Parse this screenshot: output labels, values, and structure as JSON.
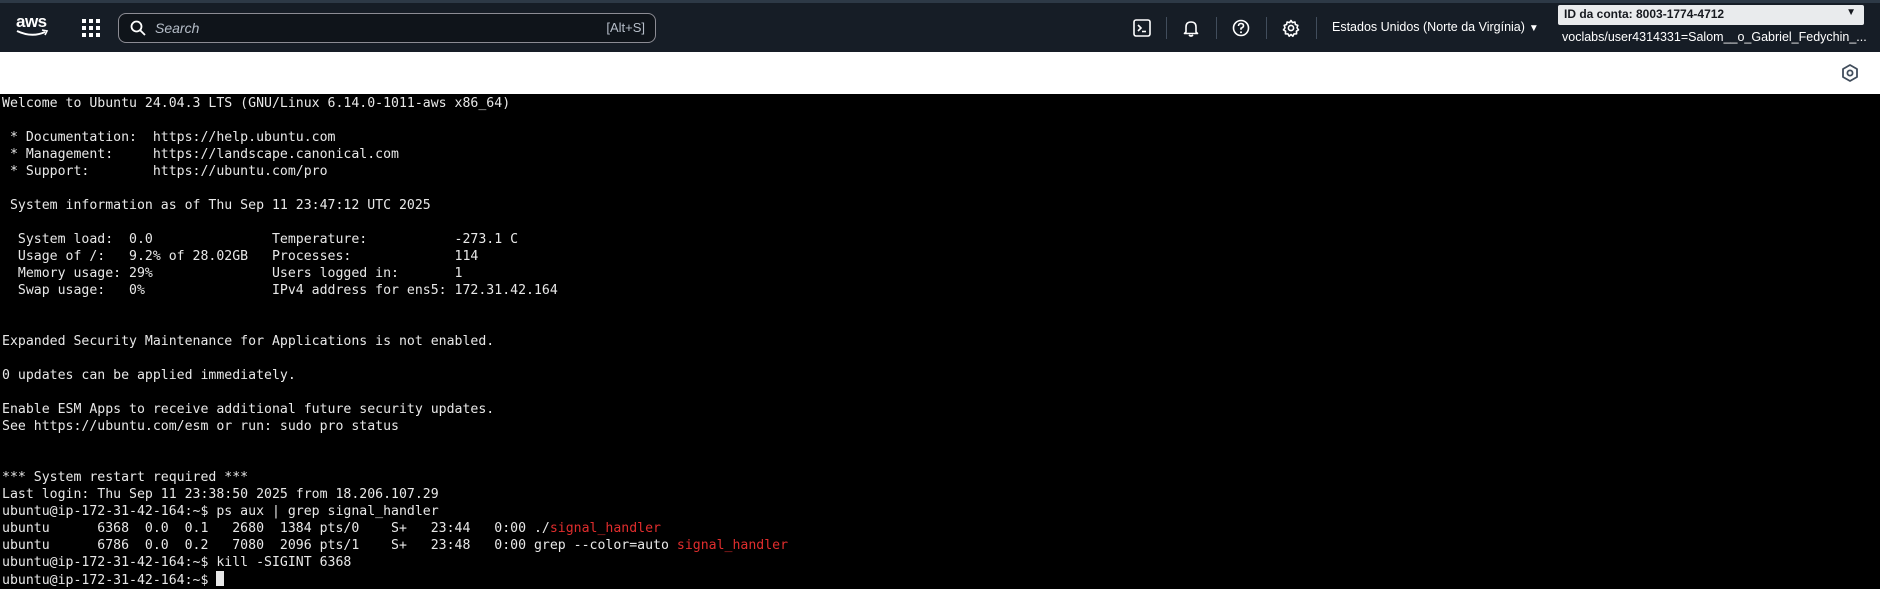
{
  "topbar": {
    "logo_text": "aws",
    "search": {
      "placeholder": "Search",
      "shortcut": "[Alt+S]"
    },
    "icons": [
      "cloudshell-icon",
      "bell-icon",
      "help-icon",
      "gear-icon"
    ],
    "region": {
      "label": "Estados Unidos (Norte da Virgínia)",
      "caret": "▼"
    },
    "account": {
      "id_label": "ID da conta: 8003-1774-4712",
      "caret": "▼",
      "user": "voclabs/user4314331=Salom__o_Gabriel_Fedychin_..."
    }
  },
  "colors": {
    "nav_bg": "#161d26",
    "terminal_bg": "#000000",
    "terminal_fg": "#e8e8e8",
    "grep_match": "#e02d2d"
  },
  "terminal": {
    "lines": [
      {
        "t": "Welcome to Ubuntu 24.04.3 LTS (GNU/Linux 6.14.0-1011-aws x86_64)"
      },
      {
        "t": ""
      },
      {
        "t": " * Documentation:  https://help.ubuntu.com"
      },
      {
        "t": " * Management:     https://landscape.canonical.com"
      },
      {
        "t": " * Support:        https://ubuntu.com/pro"
      },
      {
        "t": ""
      },
      {
        "t": " System information as of Thu Sep 11 23:47:12 UTC 2025"
      },
      {
        "t": ""
      },
      {
        "t": "  System load:  0.0               Temperature:           -273.1 C"
      },
      {
        "t": "  Usage of /:   9.2% of 28.02GB   Processes:             114"
      },
      {
        "t": "  Memory usage: 29%               Users logged in:       1"
      },
      {
        "t": "  Swap usage:   0%                IPv4 address for ens5: 172.31.42.164"
      },
      {
        "t": ""
      },
      {
        "t": ""
      },
      {
        "t": "Expanded Security Maintenance for Applications is not enabled."
      },
      {
        "t": ""
      },
      {
        "t": "0 updates can be applied immediately."
      },
      {
        "t": ""
      },
      {
        "t": "Enable ESM Apps to receive additional future security updates."
      },
      {
        "t": "See https://ubuntu.com/esm or run: sudo pro status"
      },
      {
        "t": ""
      },
      {
        "t": ""
      },
      {
        "t": "*** System restart required ***"
      },
      {
        "t": "Last login: Thu Sep 11 23:38:50 2025 from 18.206.107.29"
      },
      {
        "t": "ubuntu@ip-172-31-42-164:~$ ps aux | grep signal_handler"
      },
      {
        "t": "ubuntu      6368  0.0  0.1   2680  1384 pts/0    S+   23:44   0:00 ./",
        "hl": "signal_handler"
      },
      {
        "t": "ubuntu      6786  0.0  0.2   7080  2096 pts/1    S+   23:48   0:00 grep --color=auto ",
        "hl": "signal_handler"
      },
      {
        "t": "ubuntu@ip-172-31-42-164:~$ kill -SIGINT 6368"
      },
      {
        "t": "ubuntu@ip-172-31-42-164:~$ ",
        "cursor": true
      }
    ]
  }
}
